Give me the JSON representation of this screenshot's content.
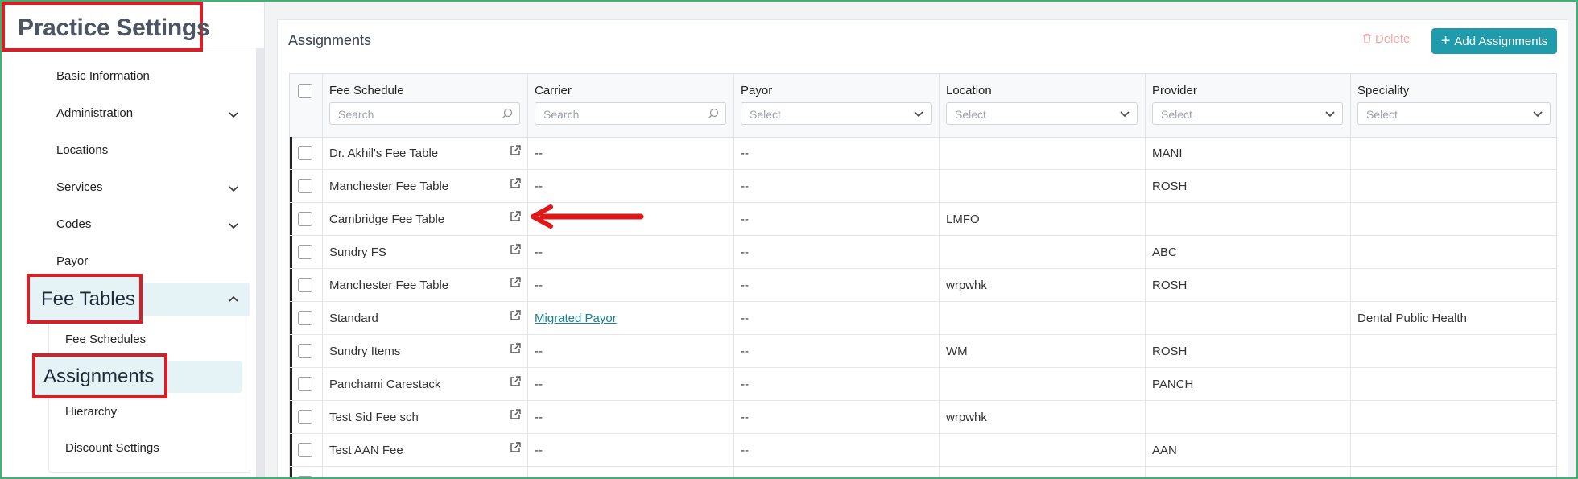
{
  "sidebar": {
    "title": "Practice Settings",
    "items": [
      {
        "label": "Basic Information",
        "expandable": false
      },
      {
        "label": "Administration",
        "expandable": true
      },
      {
        "label": "Locations",
        "expandable": false
      },
      {
        "label": "Services",
        "expandable": true
      },
      {
        "label": "Codes",
        "expandable": true
      },
      {
        "label": "Payor",
        "expandable": false
      }
    ],
    "fee_tables": {
      "label": "Fee Tables",
      "sub_items": [
        "Fee Schedules",
        "Assignments",
        "Hierarchy",
        "Discount Settings"
      ],
      "active": "Assignments"
    }
  },
  "main": {
    "title": "Assignments",
    "delete_label": "Delete",
    "add_label": "Add Assignments",
    "columns": [
      {
        "label": "Fee Schedule",
        "filter": "Search"
      },
      {
        "label": "Carrier",
        "filter": "Search"
      },
      {
        "label": "Payor",
        "filter": "Select"
      },
      {
        "label": "Location",
        "filter": "Select"
      },
      {
        "label": "Provider",
        "filter": "Select"
      },
      {
        "label": "Speciality",
        "filter": "Select"
      }
    ],
    "rows": [
      {
        "fee_schedule": "Dr. Akhil's Fee Table",
        "carrier": "--",
        "payor": "--",
        "location": "",
        "provider": "MANI",
        "speciality": ""
      },
      {
        "fee_schedule": "Manchester Fee Table",
        "carrier": "--",
        "payor": "--",
        "location": "",
        "provider": "ROSH",
        "speciality": ""
      },
      {
        "fee_schedule": "Cambridge Fee Table",
        "carrier": "",
        "payor": "--",
        "location": "LMFO",
        "provider": "",
        "speciality": ""
      },
      {
        "fee_schedule": "Sundry FS",
        "carrier": "--",
        "payor": "--",
        "location": "",
        "provider": "ABC",
        "speciality": ""
      },
      {
        "fee_schedule": "Manchester Fee Table",
        "carrier": "--",
        "payor": "--",
        "location": "wrpwhk",
        "provider": "ROSH",
        "speciality": ""
      },
      {
        "fee_schedule": "Standard",
        "carrier": "Migrated Payor",
        "payor": "--",
        "location": "",
        "provider": "",
        "speciality": "Dental Public Health"
      },
      {
        "fee_schedule": "Sundry Items",
        "carrier": "--",
        "payor": "--",
        "location": "WM",
        "provider": "ROSH",
        "speciality": ""
      },
      {
        "fee_schedule": "Panchami Carestack",
        "carrier": "--",
        "payor": "--",
        "location": "",
        "provider": "PANCH",
        "speciality": ""
      },
      {
        "fee_schedule": "Test Sid Fee sch",
        "carrier": "--",
        "payor": "--",
        "location": "wrpwhk",
        "provider": "",
        "speciality": ""
      },
      {
        "fee_schedule": "Test AAN Fee",
        "carrier": "--",
        "payor": "--",
        "location": "",
        "provider": "AAN",
        "speciality": ""
      }
    ]
  },
  "colors": {
    "accent": "#1f9bab",
    "annotation": "#d91f26",
    "active_bg": "#e6f3f6"
  }
}
